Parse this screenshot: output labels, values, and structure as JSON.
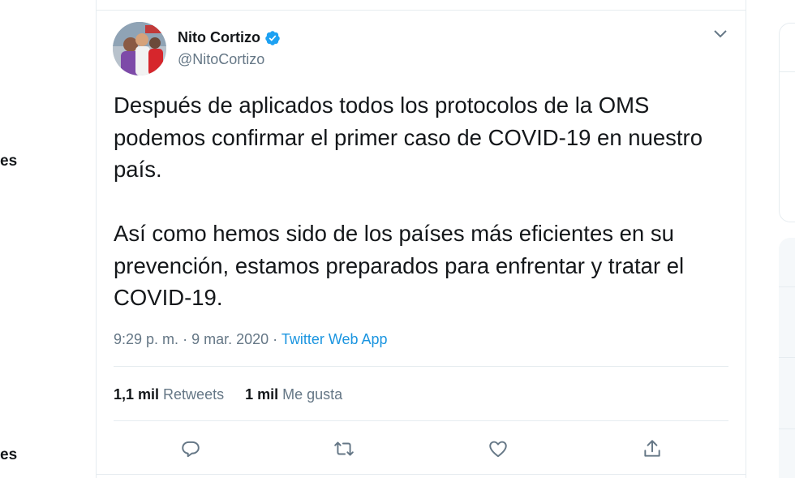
{
  "left_nav": {
    "fragment_1": "es",
    "fragment_2": "es"
  },
  "tweet": {
    "author_name": "Nito Cortizo",
    "author_handle": "@NitoCortizo",
    "verified": true,
    "paragraphs": [
      "Después de aplicados todos los protocolos de la OMS podemos confirmar el primer caso de COVID-19 en nuestro país.",
      "Así como hemos sido de los países más eficientes en su prevención, estamos preparados para enfrentar y tratar el COVID-19."
    ],
    "time": "9:29 p. m.",
    "date": "9 mar. 2020",
    "separator": "·",
    "source_app": "Twitter Web App",
    "retweets_count": "1,1 mil",
    "retweets_label": "Retweets",
    "likes_count": "1 mil",
    "likes_label": "Me gusta"
  },
  "icons": {
    "menu": "chevron-down-icon",
    "reply": "reply-icon",
    "retweet": "retweet-icon",
    "like": "heart-icon",
    "share": "share-icon",
    "verified": "verified-badge-icon"
  },
  "colors": {
    "accent": "#1b95e0",
    "verified": "#1da1f2",
    "muted": "#657786",
    "text": "#14171a",
    "border": "#e6ecf0"
  }
}
